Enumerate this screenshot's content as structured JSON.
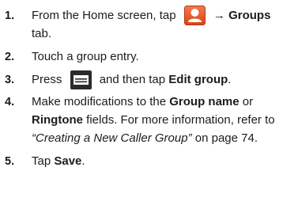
{
  "steps": [
    {
      "number": "1.",
      "line1_pre": "From the Home screen, tap",
      "line1_post": "→ Groups",
      "line2": "tab.",
      "icon": "contacts-icon"
    },
    {
      "number": "2.",
      "line1": "Touch a group entry."
    },
    {
      "number": "3.",
      "line1_pre": "Press",
      "line1_mid": "and then tap",
      "line1_bold": "Edit group",
      "line1_end": ".",
      "icon": "menu-key-icon"
    },
    {
      "number": "4.",
      "line1_pre": "Make modifications to the",
      "line1_bold1": "Group name",
      "line1_post": "or",
      "line2_bold": "Ringtone",
      "line2_post": "fields. For more information, refer to",
      "line3_italic": "“Creating a New Caller Group”",
      "line3_post": " on page 74."
    },
    {
      "number": "5.",
      "line1_pre": "Tap",
      "line1_bold": "Save",
      "line1_end": "."
    }
  ],
  "colors": {
    "contacts_icon_bg": "#e8562a",
    "menu_icon_bg": "#2b2b2b"
  }
}
